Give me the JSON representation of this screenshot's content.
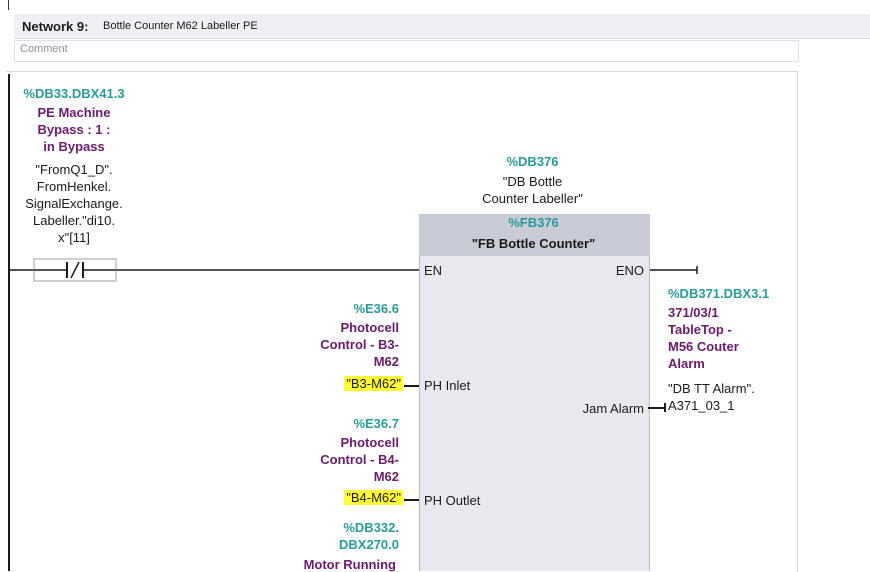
{
  "network": {
    "label": "Network 9:",
    "title": "Bottle Counter M62 Labeller  PE",
    "comment_placeholder": "Comment"
  },
  "contact": {
    "address": "%DB33.DBX41.3",
    "symbol_lines": [
      "PE Machine",
      "Bypass : 1 :",
      "in Bypass"
    ],
    "tag_lines": [
      "\"FromQ1_D\".",
      "FromHenkel.",
      "SignalExchange.",
      "Labeller.\"di10.",
      "x\"[11]"
    ],
    "type": "normally-closed"
  },
  "block": {
    "instance_db": "%DB376",
    "instance_name_lines": [
      "\"DB Bottle",
      "Counter Labeller\""
    ],
    "fb_number": "%FB376",
    "fb_name": "\"FB Bottle Counter\"",
    "pin_en": "EN",
    "pin_eno": "ENO",
    "pin_ph_inlet": "PH Inlet",
    "pin_ph_outlet": "PH Outlet",
    "pin_jam_alarm": "Jam Alarm"
  },
  "inputs": {
    "ph_inlet": {
      "address": "%E36.6",
      "symbol_lines": [
        "Photocell",
        "Control - B3-",
        "M62"
      ],
      "tag": "\"B3-M62\""
    },
    "ph_outlet": {
      "address": "%E36.7",
      "symbol_lines": [
        "Photocell",
        "Control - B4-",
        "M62"
      ],
      "tag": "\"B4-M62\""
    },
    "motor": {
      "address_lines": [
        "%DB332.",
        "DBX270.0"
      ],
      "symbol": "Motor Running"
    }
  },
  "outputs": {
    "jam_alarm": {
      "address": "%DB371.DBX3.1",
      "symbol_lines": [
        "371/03/1",
        "TableTop -",
        "M56 Couter",
        "Alarm"
      ],
      "tag_lines": [
        "\"DB TT Alarm\".",
        "A371_03_1"
      ]
    }
  },
  "colors": {
    "address": "#2a9a9a",
    "symbol": "#6b1b6e",
    "highlight": "#ffff33",
    "block_body": "#e8e8ee",
    "block_header": "#c9cbd6"
  }
}
